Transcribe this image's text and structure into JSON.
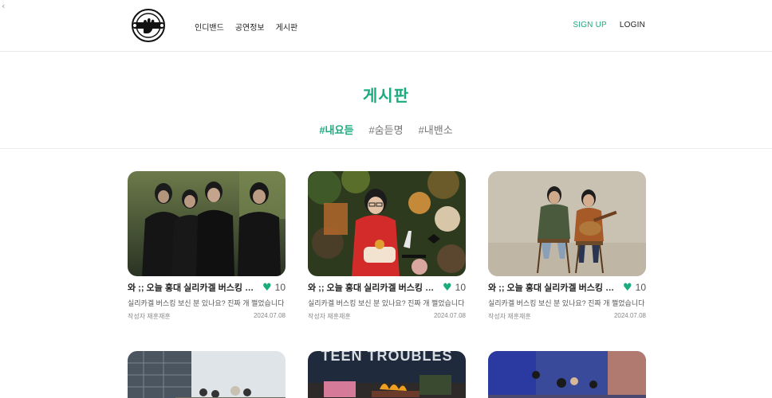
{
  "nav": {
    "back_symbol": "‹",
    "items": [
      "인디밴드",
      "공연정보",
      "게시판"
    ],
    "signup": "SIGN UP",
    "login": "LOGIN"
  },
  "page": {
    "title": "게시판",
    "tabs": [
      "#내요듣",
      "#숨듣명",
      "#내밴소"
    ],
    "active_tab": 0
  },
  "colors": {
    "accent": "#1aab7e"
  },
  "posts": [
    {
      "title": "와 ;; 오늘 홍대 실리카겔 버스킹 미쳤다 ㄷㄷ",
      "likes": "10",
      "excerpt": "실리카겔 버스킹 보신 분 있나요? 진짜 개 쩔었습니다",
      "author": "작성자 재훈재훈",
      "date": "2024.07.08"
    },
    {
      "title": "와 ;; 오늘 홍대 실리카겔 버스킹 미쳤다 ㄷㄷ",
      "likes": "10",
      "excerpt": "실리카겔 버스킹 보신 분 있나요? 진짜 개 쩔었습니다",
      "author": "작성자 재훈재훈",
      "date": "2024.07.08"
    },
    {
      "title": "와 ;; 오늘 홍대 실리카겔 버스킹 미쳤다 ㄷㄷ",
      "likes": "10",
      "excerpt": "실리카겔 버스킹 보신 분 있나요? 진짜 개 쩔었습니다",
      "author": "작성자 재훈재훈",
      "date": "2024.07.08"
    }
  ],
  "second_row": {
    "poster_text": "TEEN TROUBLES"
  }
}
